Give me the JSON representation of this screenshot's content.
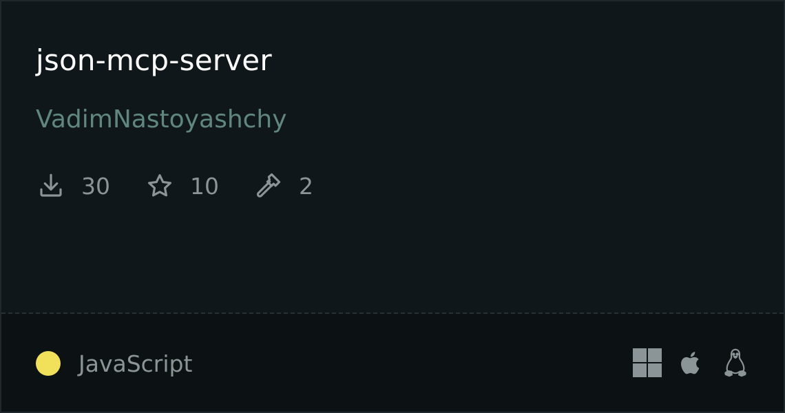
{
  "server": {
    "name": "json-mcp-server",
    "owner": "VadimNastoyashchy"
  },
  "stats": [
    {
      "icon": "download-icon",
      "value": "30"
    },
    {
      "icon": "star-icon",
      "value": "10"
    },
    {
      "icon": "hammer-icon",
      "value": "2"
    }
  ],
  "language": {
    "name": "JavaScript",
    "color": "#f1e05a"
  },
  "platforms": [
    {
      "icon": "windows-icon"
    },
    {
      "icon": "apple-icon"
    },
    {
      "icon": "linux-icon"
    }
  ]
}
